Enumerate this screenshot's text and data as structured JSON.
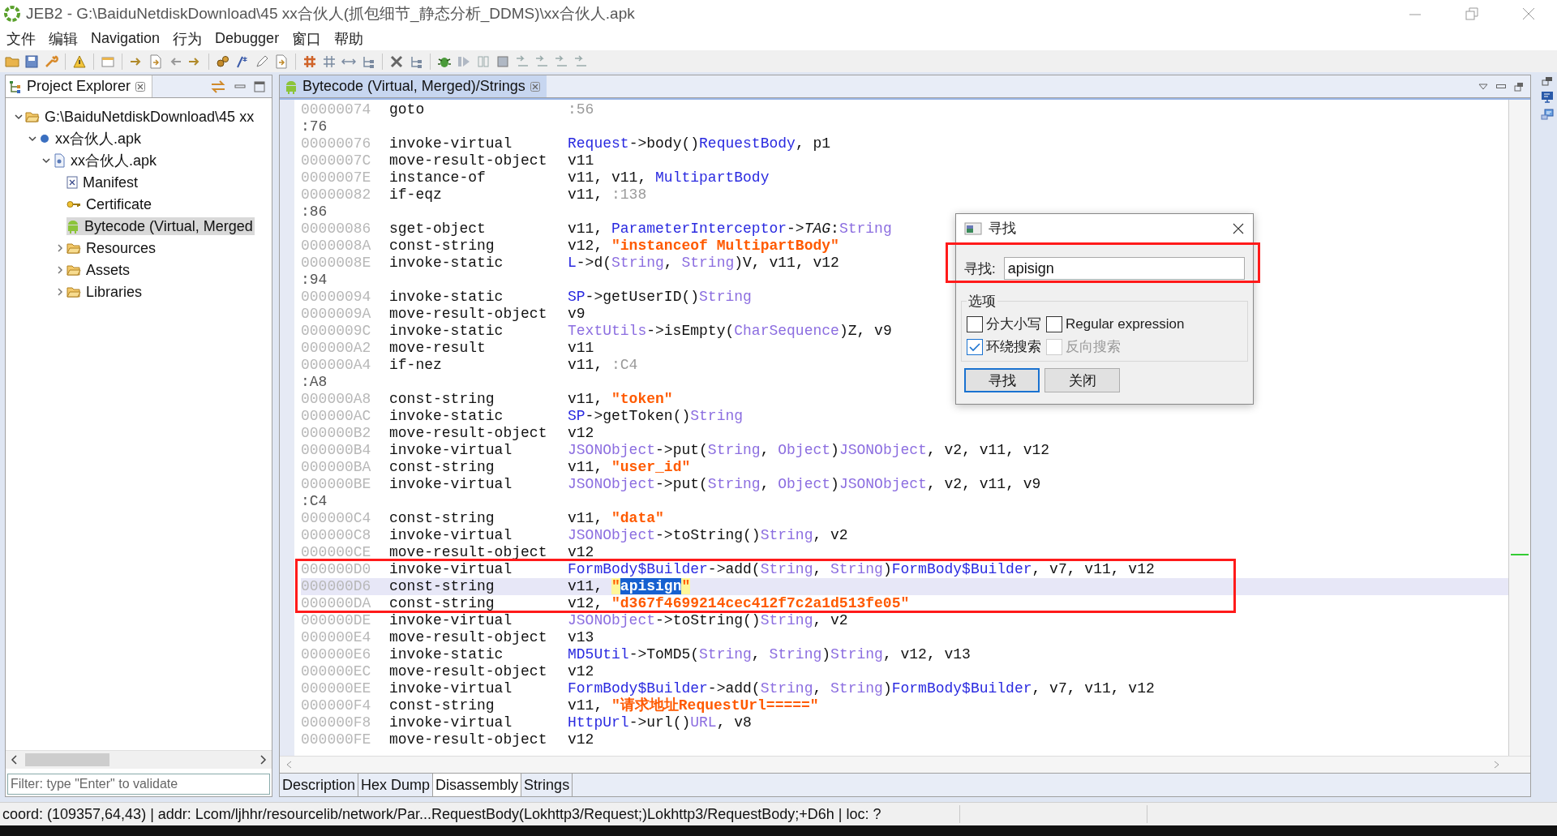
{
  "window": {
    "title": "JEB2 - G:\\BaiduNetdiskDownload\\45 xx合伙人(抓包细节_静态分析_DDMS)\\xx合伙人.apk"
  },
  "menu": [
    "文件",
    "编辑",
    "Navigation",
    "行为",
    "Debugger",
    "窗口",
    "帮助"
  ],
  "project_explorer": {
    "title": "Project Explorer",
    "tree": [
      {
        "label": "G:\\BaiduNetdiskDownload\\45 xx",
        "kind": "folder",
        "expanded": true,
        "selected": false,
        "children": [
          {
            "label": "xx合伙人.apk",
            "kind": "artifact",
            "expanded": true,
            "selected": false,
            "children": [
              {
                "label": "xx合伙人.apk",
                "kind": "apk",
                "expanded": true,
                "selected": false,
                "children": [
                  {
                    "label": "Manifest",
                    "kind": "manifest",
                    "selected": false
                  },
                  {
                    "label": "Certificate",
                    "kind": "certificate",
                    "selected": false
                  },
                  {
                    "label": "Bytecode (Virtual, Merged",
                    "kind": "bytecode",
                    "selected": true
                  },
                  {
                    "label": "Resources",
                    "kind": "folder",
                    "expanded": false,
                    "selected": false
                  },
                  {
                    "label": "Assets",
                    "kind": "folder",
                    "expanded": false,
                    "selected": false
                  },
                  {
                    "label": "Libraries",
                    "kind": "folder",
                    "expanded": false,
                    "selected": false
                  }
                ]
              }
            ]
          }
        ]
      }
    ],
    "filter": {
      "placeholder": "Filter: type \"Enter\" to validate"
    }
  },
  "editor": {
    "tab": {
      "label": "Bytecode (Virtual, Merged)/Strings"
    },
    "lines": [
      {
        "kind": "insn",
        "selected": false,
        "addr": "00000074",
        "op": "goto",
        "args": [
          {
            "kind": "label",
            "text": ":56"
          }
        ]
      },
      {
        "kind": "label",
        "selected": false,
        "text": ":76"
      },
      {
        "kind": "insn",
        "selected": false,
        "addr": "00000076",
        "op": "invoke-virtual",
        "args": [
          {
            "kind": "class",
            "text": "Request"
          },
          {
            "kind": "plain",
            "text": "->body()"
          },
          {
            "kind": "class",
            "text": "RequestBody"
          },
          {
            "kind": "plain",
            "text": ", p1"
          }
        ]
      },
      {
        "kind": "insn",
        "selected": false,
        "addr": "0000007C",
        "op": "move-result-object",
        "args": [
          {
            "kind": "plain",
            "text": "v11"
          }
        ]
      },
      {
        "kind": "insn",
        "selected": false,
        "addr": "0000007E",
        "op": "instance-of",
        "args": [
          {
            "kind": "plain",
            "text": "v11, v11, "
          },
          {
            "kind": "class",
            "text": "MultipartBody"
          }
        ]
      },
      {
        "kind": "insn",
        "selected": false,
        "addr": "00000082",
        "op": "if-eqz",
        "args": [
          {
            "kind": "plain",
            "text": "v11, "
          },
          {
            "kind": "label",
            "text": ":138"
          }
        ]
      },
      {
        "kind": "label",
        "selected": false,
        "text": ":86"
      },
      {
        "kind": "insn",
        "selected": false,
        "addr": "00000086",
        "op": "sget-object",
        "args": [
          {
            "kind": "plain",
            "text": "v11, "
          },
          {
            "kind": "class",
            "text": "ParameterInterceptor"
          },
          {
            "kind": "plain",
            "text": "->"
          },
          {
            "kind": "field",
            "text": "TAG"
          },
          {
            "kind": "plain",
            "text": ":"
          },
          {
            "kind": "type",
            "text": "String"
          }
        ]
      },
      {
        "kind": "insn",
        "selected": false,
        "addr": "0000008A",
        "op": "const-string",
        "args": [
          {
            "kind": "plain",
            "text": "v12, "
          },
          {
            "kind": "string",
            "text": "\"instanceof MultipartBody\""
          }
        ]
      },
      {
        "kind": "insn",
        "selected": false,
        "addr": "0000008E",
        "op": "invoke-static",
        "args": [
          {
            "kind": "class",
            "text": "L"
          },
          {
            "kind": "plain",
            "text": "->d("
          },
          {
            "kind": "type",
            "text": "String"
          },
          {
            "kind": "plain",
            "text": ", "
          },
          {
            "kind": "type",
            "text": "String"
          },
          {
            "kind": "plain",
            "text": ")V, v11, v12"
          }
        ]
      },
      {
        "kind": "label",
        "selected": false,
        "text": ":94"
      },
      {
        "kind": "insn",
        "selected": false,
        "addr": "00000094",
        "op": "invoke-static",
        "args": [
          {
            "kind": "class",
            "text": "SP"
          },
          {
            "kind": "plain",
            "text": "->getUserID()"
          },
          {
            "kind": "type",
            "text": "String"
          }
        ]
      },
      {
        "kind": "insn",
        "selected": false,
        "addr": "0000009A",
        "op": "move-result-object",
        "args": [
          {
            "kind": "plain",
            "text": "v9"
          }
        ]
      },
      {
        "kind": "insn",
        "selected": false,
        "addr": "0000009C",
        "op": "invoke-static",
        "args": [
          {
            "kind": "type",
            "text": "TextUtils"
          },
          {
            "kind": "plain",
            "text": "->isEmpty("
          },
          {
            "kind": "type",
            "text": "CharSequence"
          },
          {
            "kind": "plain",
            "text": ")Z, v9"
          }
        ]
      },
      {
        "kind": "insn",
        "selected": false,
        "addr": "000000A2",
        "op": "move-result",
        "args": [
          {
            "kind": "plain",
            "text": "v11"
          }
        ]
      },
      {
        "kind": "insn",
        "selected": false,
        "addr": "000000A4",
        "op": "if-nez",
        "args": [
          {
            "kind": "plain",
            "text": "v11, "
          },
          {
            "kind": "label",
            "text": ":C4"
          }
        ]
      },
      {
        "kind": "label",
        "selected": false,
        "text": ":A8"
      },
      {
        "kind": "insn",
        "selected": false,
        "addr": "000000A8",
        "op": "const-string",
        "args": [
          {
            "kind": "plain",
            "text": "v11, "
          },
          {
            "kind": "string",
            "text": "\"token\""
          }
        ]
      },
      {
        "kind": "insn",
        "selected": false,
        "addr": "000000AC",
        "op": "invoke-static",
        "args": [
          {
            "kind": "class",
            "text": "SP"
          },
          {
            "kind": "plain",
            "text": "->getToken()"
          },
          {
            "kind": "type",
            "text": "String"
          }
        ]
      },
      {
        "kind": "insn",
        "selected": false,
        "addr": "000000B2",
        "op": "move-result-object",
        "args": [
          {
            "kind": "plain",
            "text": "v12"
          }
        ]
      },
      {
        "kind": "insn",
        "selected": false,
        "addr": "000000B4",
        "op": "invoke-virtual",
        "args": [
          {
            "kind": "type",
            "text": "JSONObject"
          },
          {
            "kind": "plain",
            "text": "->put("
          },
          {
            "kind": "type",
            "text": "String"
          },
          {
            "kind": "plain",
            "text": ", "
          },
          {
            "kind": "type",
            "text": "Object"
          },
          {
            "kind": "plain",
            "text": ")"
          },
          {
            "kind": "type",
            "text": "JSONObject"
          },
          {
            "kind": "plain",
            "text": ", v2, v11, v12"
          }
        ]
      },
      {
        "kind": "insn",
        "selected": false,
        "addr": "000000BA",
        "op": "const-string",
        "args": [
          {
            "kind": "plain",
            "text": "v11, "
          },
          {
            "kind": "string",
            "text": "\"user_id\""
          }
        ]
      },
      {
        "kind": "insn",
        "selected": false,
        "addr": "000000BE",
        "op": "invoke-virtual",
        "args": [
          {
            "kind": "type",
            "text": "JSONObject"
          },
          {
            "kind": "plain",
            "text": "->put("
          },
          {
            "kind": "type",
            "text": "String"
          },
          {
            "kind": "plain",
            "text": ", "
          },
          {
            "kind": "type",
            "text": "Object"
          },
          {
            "kind": "plain",
            "text": ")"
          },
          {
            "kind": "type",
            "text": "JSONObject"
          },
          {
            "kind": "plain",
            "text": ", v2, v11, v9"
          }
        ]
      },
      {
        "kind": "label",
        "selected": false,
        "text": ":C4"
      },
      {
        "kind": "insn",
        "selected": false,
        "addr": "000000C4",
        "op": "const-string",
        "args": [
          {
            "kind": "plain",
            "text": "v11, "
          },
          {
            "kind": "string",
            "text": "\"data\""
          }
        ]
      },
      {
        "kind": "insn",
        "selected": false,
        "addr": "000000C8",
        "op": "invoke-virtual",
        "args": [
          {
            "kind": "type",
            "text": "JSONObject"
          },
          {
            "kind": "plain",
            "text": "->toString()"
          },
          {
            "kind": "type",
            "text": "String"
          },
          {
            "kind": "plain",
            "text": ", v2"
          }
        ]
      },
      {
        "kind": "insn",
        "selected": false,
        "addr": "000000CE",
        "op": "move-result-object",
        "args": [
          {
            "kind": "plain",
            "text": "v12"
          }
        ]
      },
      {
        "kind": "insn",
        "selected": false,
        "addr": "000000D0",
        "op": "invoke-virtual",
        "args": [
          {
            "kind": "class",
            "text": "FormBody$Builder"
          },
          {
            "kind": "plain",
            "text": "->add("
          },
          {
            "kind": "type",
            "text": "String"
          },
          {
            "kind": "plain",
            "text": ", "
          },
          {
            "kind": "type",
            "text": "String"
          },
          {
            "kind": "plain",
            "text": ")"
          },
          {
            "kind": "class",
            "text": "FormBody$Builder"
          },
          {
            "kind": "plain",
            "text": ", v7, v11, v12"
          }
        ]
      },
      {
        "kind": "insn",
        "selected": true,
        "addr": "000000D6",
        "op": "const-string",
        "args": [
          {
            "kind": "plain",
            "text": "v11, "
          },
          {
            "kind": "quote",
            "text": "\""
          },
          {
            "kind": "match",
            "text": "apisign"
          },
          {
            "kind": "quote",
            "text": "\""
          }
        ]
      },
      {
        "kind": "insn",
        "selected": false,
        "addr": "000000DA",
        "op": "const-string",
        "args": [
          {
            "kind": "plain",
            "text": "v12, "
          },
          {
            "kind": "string",
            "text": "\"d367f4699214cec412f7c2a1d513fe05\""
          }
        ]
      },
      {
        "kind": "insn",
        "selected": false,
        "addr": "000000DE",
        "op": "invoke-virtual",
        "args": [
          {
            "kind": "type",
            "text": "JSONObject"
          },
          {
            "kind": "plain",
            "text": "->toString()"
          },
          {
            "kind": "type",
            "text": "String"
          },
          {
            "kind": "plain",
            "text": ", v2"
          }
        ]
      },
      {
        "kind": "insn",
        "selected": false,
        "addr": "000000E4",
        "op": "move-result-object",
        "args": [
          {
            "kind": "plain",
            "text": "v13"
          }
        ]
      },
      {
        "kind": "insn",
        "selected": false,
        "addr": "000000E6",
        "op": "invoke-static",
        "args": [
          {
            "kind": "class",
            "text": "MD5Util"
          },
          {
            "kind": "plain",
            "text": "->ToMD5("
          },
          {
            "kind": "type",
            "text": "String"
          },
          {
            "kind": "plain",
            "text": ", "
          },
          {
            "kind": "type",
            "text": "String"
          },
          {
            "kind": "plain",
            "text": ")"
          },
          {
            "kind": "type",
            "text": "String"
          },
          {
            "kind": "plain",
            "text": ", v12, v13"
          }
        ]
      },
      {
        "kind": "insn",
        "selected": false,
        "addr": "000000EC",
        "op": "move-result-object",
        "args": [
          {
            "kind": "plain",
            "text": "v12"
          }
        ]
      },
      {
        "kind": "insn",
        "selected": false,
        "addr": "000000EE",
        "op": "invoke-virtual",
        "args": [
          {
            "kind": "class",
            "text": "FormBody$Builder"
          },
          {
            "kind": "plain",
            "text": "->add("
          },
          {
            "kind": "type",
            "text": "String"
          },
          {
            "kind": "plain",
            "text": ", "
          },
          {
            "kind": "type",
            "text": "String"
          },
          {
            "kind": "plain",
            "text": ")"
          },
          {
            "kind": "class",
            "text": "FormBody$Builder"
          },
          {
            "kind": "plain",
            "text": ", v7, v11, v12"
          }
        ]
      },
      {
        "kind": "insn",
        "selected": false,
        "addr": "000000F4",
        "op": "const-string",
        "args": [
          {
            "kind": "plain",
            "text": "v11, "
          },
          {
            "kind": "string",
            "text": "\"请求地址RequestUrl=====\""
          }
        ]
      },
      {
        "kind": "insn",
        "selected": false,
        "addr": "000000F8",
        "op": "invoke-virtual",
        "args": [
          {
            "kind": "class",
            "text": "HttpUrl"
          },
          {
            "kind": "plain",
            "text": "->url()"
          },
          {
            "kind": "type",
            "text": "URL"
          },
          {
            "kind": "plain",
            "text": ", v8"
          }
        ]
      },
      {
        "kind": "insn",
        "selected": false,
        "addr": "000000FE",
        "op": "move-result-object",
        "args": [
          {
            "kind": "plain",
            "text": "v12"
          }
        ]
      }
    ],
    "bottom_tabs": [
      {
        "label": "Description",
        "selected": false
      },
      {
        "label": "Hex Dump",
        "selected": false
      },
      {
        "label": "Disassembly",
        "selected": true
      },
      {
        "label": "Strings",
        "selected": false
      }
    ]
  },
  "find_dialog": {
    "title": "寻找",
    "field_label": "寻找:",
    "value": "apisign",
    "group": "选项",
    "options": [
      {
        "label": "分大小写",
        "checked": false,
        "disabled": false
      },
      {
        "label": "Regular expression",
        "checked": false,
        "disabled": false
      },
      {
        "label": "环绕搜索",
        "checked": true,
        "disabled": false
      },
      {
        "label": "反向搜索",
        "checked": false,
        "disabled": true
      }
    ],
    "buttons": [
      {
        "label": "寻找",
        "default": true
      },
      {
        "label": "关闭",
        "default": false
      }
    ]
  },
  "status_bar": {
    "text": "coord: (109357,64,43) | addr: Lcom/ljhhr/resourcelib/network/Par...RequestBody(Lokhttp3/Request;)Lokhttp3/RequestBody;+D6h | loc: ?"
  }
}
